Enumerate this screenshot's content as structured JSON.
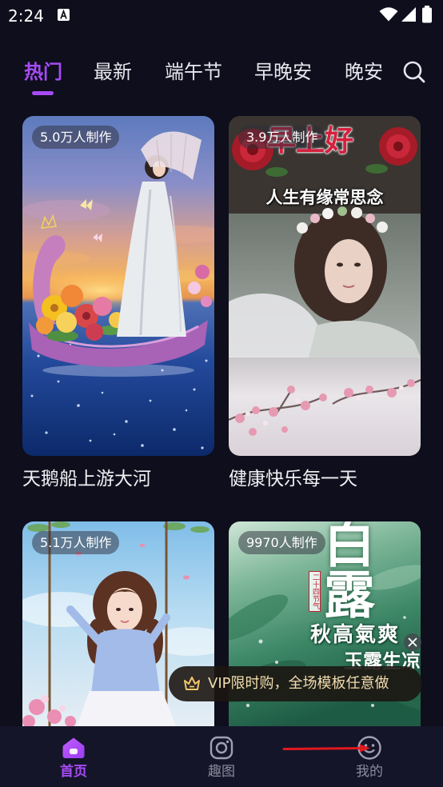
{
  "status_bar": {
    "time": "2:24",
    "notification_icon": "a-app-icon",
    "wifi_icon": "wifi-icon",
    "signal_icon": "signal-icon",
    "battery_icon": "battery-icon"
  },
  "tabs": [
    {
      "label": "热门",
      "active": true
    },
    {
      "label": "最新",
      "active": false
    },
    {
      "label": "端午节",
      "active": false
    },
    {
      "label": "早晚安",
      "active": false
    },
    {
      "label": "晚安",
      "active": false
    }
  ],
  "search_icon": "search-icon",
  "cards": [
    {
      "badge": "5.0万人制作",
      "title": "天鹅船上游大河"
    },
    {
      "badge": "3.9万人制作",
      "title": "健康快乐每一天",
      "image_text": [
        "早上好",
        "人生有缘常思念"
      ]
    },
    {
      "badge": "5.1万人制作"
    },
    {
      "badge": "9970人制作",
      "image_text": [
        "白露",
        "二十四节气",
        "秋高氣爽",
        "玉露生凉"
      ]
    }
  ],
  "promo": {
    "icon": "crown-icon",
    "text": "VIP限时购，全场模板任意做",
    "close_icon": "close-icon"
  },
  "bottom_nav": [
    {
      "label": "首页",
      "icon": "home-icon",
      "active": true
    },
    {
      "label": "趣图",
      "icon": "camera-icon",
      "active": false
    },
    {
      "label": "我的",
      "icon": "smiley-icon",
      "active": false
    }
  ],
  "colors": {
    "accent": "#a64bf4",
    "background": "#0e0e1c",
    "nav_background": "#15152a",
    "promo_text": "#f3dcae",
    "annotation": "#e0191e"
  }
}
